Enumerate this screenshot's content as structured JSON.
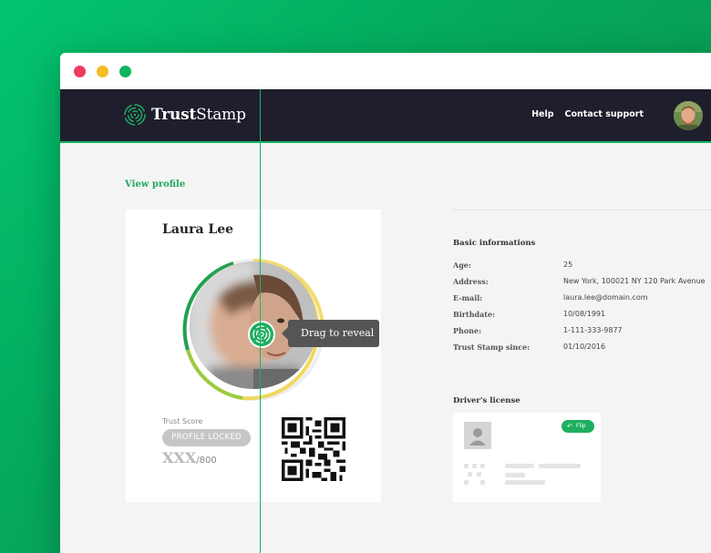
{
  "window": {
    "controls": [
      "close",
      "minimize",
      "maximize"
    ]
  },
  "nav": {
    "logo_bold": "Trust",
    "logo_rest": "Stamp",
    "links": [
      "Help",
      "Contact support"
    ]
  },
  "profile": {
    "view_profile_link": "View profile",
    "name": "Laura Lee",
    "drag_tooltip": "Drag to reveal",
    "trust_score_label": "Trust Score",
    "locked_badge": "PROFILE LOCKED",
    "score_hidden": "XXX",
    "score_max": "/800"
  },
  "info": {
    "title": "Basic informations",
    "rows": [
      {
        "key": "Age:",
        "value": "25"
      },
      {
        "key": "Address:",
        "value": "New York, 100021 NY 120 Park Avenue"
      },
      {
        "key": "E-mail:",
        "value": "laura.lee@domain.com"
      },
      {
        "key": "Birthdate:",
        "value": "10/08/1991"
      },
      {
        "key": "Phone:",
        "value": "1-111-333-9877"
      },
      {
        "key": "Trust Stamp since:",
        "value": "01/10/2016"
      }
    ]
  },
  "license": {
    "title": "Driver's license",
    "flip_label": "Flip"
  },
  "colors": {
    "brand_green": "#1fae5f",
    "nav_bg": "#1e1e2c",
    "ring_green": "#23a04f",
    "ring_yellow": "#f0d44a",
    "tooltip_bg": "#555555"
  },
  "icons": [
    "fingerprint-icon",
    "user-placeholder-icon",
    "undo-arrow-icon",
    "qr-code"
  ]
}
